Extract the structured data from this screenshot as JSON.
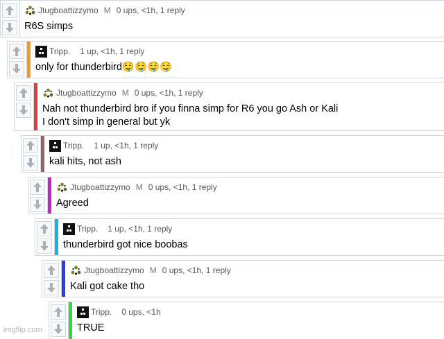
{
  "comments": [
    {
      "username": "Jtugboattizzymo",
      "avatar": "leaf-cluster-avatar",
      "badge": "M",
      "stats": "0 ups, <1h, 1 reply",
      "text": "R6S simps",
      "bar_color": ""
    },
    {
      "username": "Tripp.",
      "avatar": "black-pixel-avatar",
      "badge": "",
      "stats": "1 up, <1h, 1 reply",
      "text": "only for thunderbird🤤🤤🤤🤤",
      "bar_color": "#f39a1e"
    },
    {
      "username": "Jtugboattizzymo",
      "avatar": "leaf-cluster-avatar",
      "badge": "M",
      "stats": "0 ups, <1h, 1 reply",
      "text": "Nah not thunderbird bro if you finna simp for R6 you go Ash or Kali\nI don't simp in general but yk",
      "bar_color": "#e03a3a"
    },
    {
      "username": "Tripp.",
      "avatar": "black-pixel-avatar",
      "badge": "",
      "stats": "1 up, <1h, 1 reply",
      "text": "kali hits, not ash",
      "bar_color": "#9a6362"
    },
    {
      "username": "Jtugboattizzymo",
      "avatar": "leaf-cluster-avatar",
      "badge": "M",
      "stats": "0 ups, <1h, 1 reply",
      "text": "Agreed",
      "bar_color": "#c326c4"
    },
    {
      "username": "Tripp.",
      "avatar": "black-pixel-avatar",
      "badge": "",
      "stats": "1 up, <1h, 1 reply",
      "text": "thunderbird got nice boobas",
      "bar_color": "#1fb1e6"
    },
    {
      "username": "Jtugboattizzymo",
      "avatar": "leaf-cluster-avatar",
      "badge": "M",
      "stats": "0 ups, <1h, 1 reply",
      "text": "Kali got cake tho",
      "bar_color": "#2b3fe0"
    },
    {
      "username": "Tripp.",
      "avatar": "black-pixel-avatar",
      "badge": "",
      "stats": "0 ups, <1h",
      "text": "TRUE",
      "bar_color": "#33d944"
    }
  ],
  "watermark": "imgflip.com"
}
